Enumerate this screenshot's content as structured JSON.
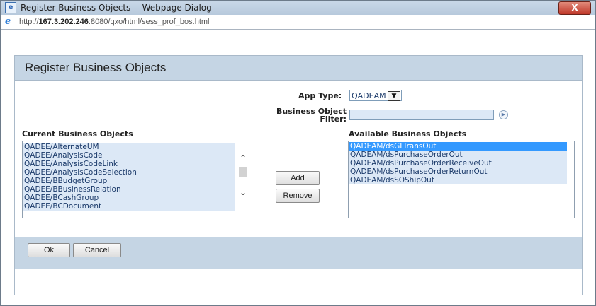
{
  "window": {
    "title": "Register Business Objects -- Webpage Dialog",
    "close_label": "X"
  },
  "address": {
    "prefix": "http://",
    "host": "167.3.202.246",
    "rest": ":8080/qxo/html/sess_prof_bos.html"
  },
  "panel": {
    "title": "Register Business Objects"
  },
  "form": {
    "app_type_label": "App Type:",
    "app_type_value": "QADEAM",
    "filter_label_line1": "Business Object",
    "filter_label_line2": "Filter:",
    "filter_value": ""
  },
  "current": {
    "heading": "Current Business Objects",
    "items": [
      "QADEE/AlternateUM",
      "QADEE/AnalysisCode",
      "QADEE/AnalysisCodeLink",
      "QADEE/AnalysisCodeSelection",
      "QADEE/BBudgetGroup",
      "QADEE/BBusinessRelation",
      "QADEE/BCashGroup",
      "QADEE/BCDocument"
    ]
  },
  "available": {
    "heading": "Available Business Objects",
    "items": [
      "QADEAM/dsGLTransOut",
      "QADEAM/dsPurchaseOrderOut",
      "QADEAM/dsPurchaseOrderReceiveOut",
      "QADEAM/dsPurchaseOrderReturnOut",
      "QADEAM/dsSOShipOut"
    ]
  },
  "buttons": {
    "add": "Add",
    "remove": "Remove",
    "ok": "Ok",
    "cancel": "Cancel"
  }
}
